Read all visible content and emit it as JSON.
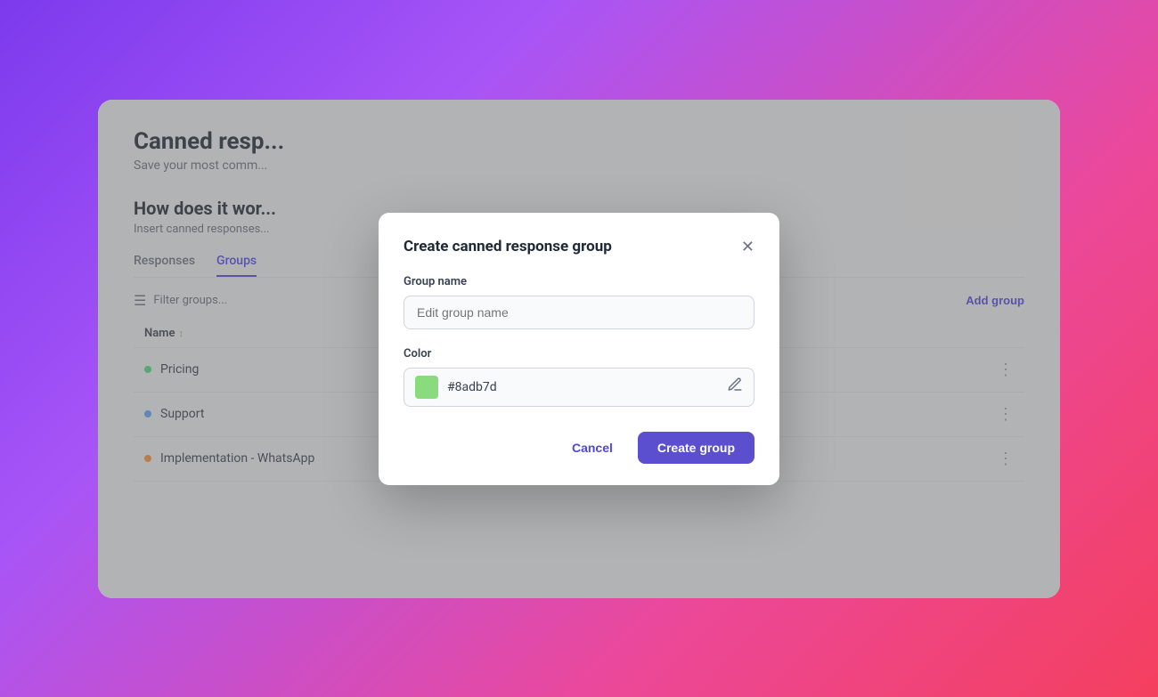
{
  "page": {
    "title": "Canned resp...",
    "subtitle": "Save your most comm...",
    "how_title": "How does it wor...",
    "how_desc": "Insert canned responses..."
  },
  "tabs": [
    {
      "label": "Responses",
      "active": false
    },
    {
      "label": "Groups",
      "active": true
    }
  ],
  "toolbar": {
    "filter_placeholder": "Filter groups...",
    "add_group_label": "Add group"
  },
  "table": {
    "name_col": "Name",
    "rows": [
      {
        "label": "Pricing",
        "dot_color": "#4ade80"
      },
      {
        "label": "Support",
        "dot_color": "#60a5fa"
      },
      {
        "label": "Implementation - WhatsApp",
        "dot_color": "#fb923c"
      }
    ]
  },
  "modal": {
    "title": "Create canned response group",
    "group_name_label": "Group name",
    "group_name_placeholder": "Edit group name",
    "color_label": "Color",
    "color_hex": "#8adb7d",
    "color_swatch": "#8adb7d",
    "cancel_label": "Cancel",
    "create_label": "Create group"
  }
}
